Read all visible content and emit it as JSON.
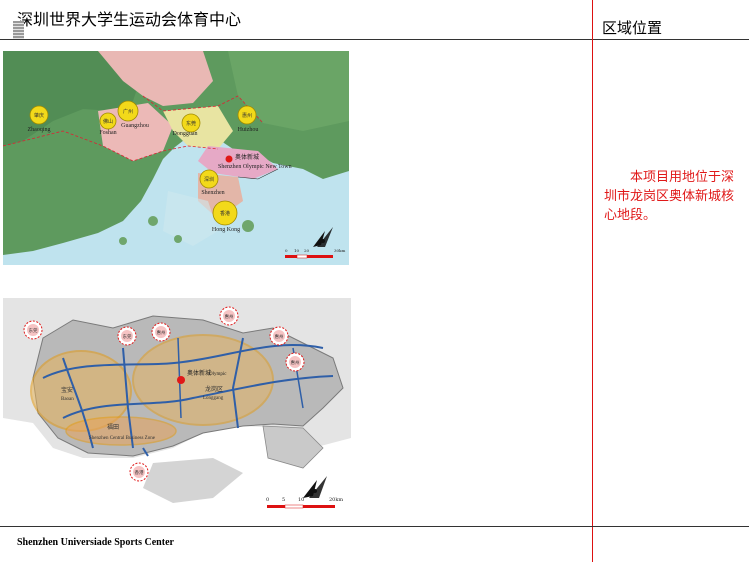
{
  "header": {
    "title": "深圳世界大学生运动会体育中心",
    "section_title": "区域位置"
  },
  "description": "本项目用地位于深圳市龙岗区奥体新城核心地段。",
  "footer": {
    "text": "Shenzhen Universiade Sports Center"
  },
  "colors": {
    "accent_red": "#e01818",
    "divider_red": "#dd1111",
    "city_marker_yellow": "#f2d91a",
    "road_blue": "#2f5fa8"
  },
  "regional_map": {
    "cities": [
      {
        "cn": "肇庆",
        "en": "Zhaoqing"
      },
      {
        "cn": "佛山",
        "en": "Foshan"
      },
      {
        "cn": "广州",
        "en": "Guangzhou"
      },
      {
        "cn": "东莞",
        "en": "Dongguan"
      },
      {
        "cn": "惠州",
        "en": "Huizhou"
      },
      {
        "cn": "深圳",
        "en": "Shenzhen"
      },
      {
        "cn": "香港",
        "en": "Hong Kong"
      }
    ],
    "site": {
      "cn": "奥体新城",
      "en": "Shenzhen Olympic New Town"
    },
    "scale": {
      "ticks": [
        "0",
        "10",
        "20",
        "30km"
      ]
    }
  },
  "city_map": {
    "zones": [
      {
        "cn": "宝安",
        "en": "Baoan"
      },
      {
        "cn": "龙岗区",
        "en": "Longgang"
      },
      {
        "cn": "福田",
        "en": "Shenzhen Central Business Zone"
      }
    ],
    "site": {
      "cn": "奥体新城",
      "en": "Olympic"
    },
    "markers": [
      "东莞",
      "东莞",
      "惠州",
      "惠州",
      "惠州",
      "惠州",
      "香港"
    ],
    "scale": {
      "ticks": [
        "0",
        "5",
        "10",
        "20km"
      ]
    }
  }
}
